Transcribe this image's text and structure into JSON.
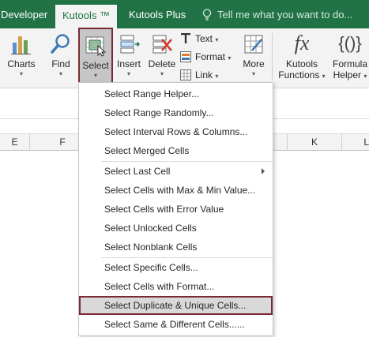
{
  "tabs": {
    "developer": "Developer",
    "kutools": "Kutools ™",
    "kutools_plus": "Kutools Plus",
    "tell_me": "Tell me what you want to do..."
  },
  "ribbon": {
    "charts": "Charts",
    "find": "Find",
    "select": "Select",
    "insert": "Insert",
    "delete": "Delete",
    "text": "Text",
    "format": "Format",
    "link": "Link",
    "more": "More",
    "kutools_functions_1": "Kutools",
    "kutools_functions_2": "Functions",
    "formula_helper_1": "Formula",
    "formula_helper_2": "Helper",
    "fx_glyph": "fx",
    "braces_glyph": "{()}",
    "dropdown_arrow": "▾"
  },
  "columns": [
    "E",
    "F",
    "",
    "",
    "",
    "",
    "",
    "K",
    "L"
  ],
  "menu": {
    "items": [
      "Select Range Helper...",
      "Select Range Randomly...",
      "Select Interval Rows & Columns...",
      "Select Merged Cells",
      "Select Last Cell",
      "Select Cells with Max & Min Value...",
      "Select Cells with Error Value",
      "Select Unlocked Cells",
      "Select Nonblank Cells",
      "Select Specific Cells...",
      "Select Cells with Format...",
      "Select Duplicate & Unique Cells...",
      "Select Same & Different Cells......"
    ],
    "highlighted_index": 11
  },
  "colors": {
    "accent_green": "#217346",
    "highlight_border": "#7a2a30"
  }
}
